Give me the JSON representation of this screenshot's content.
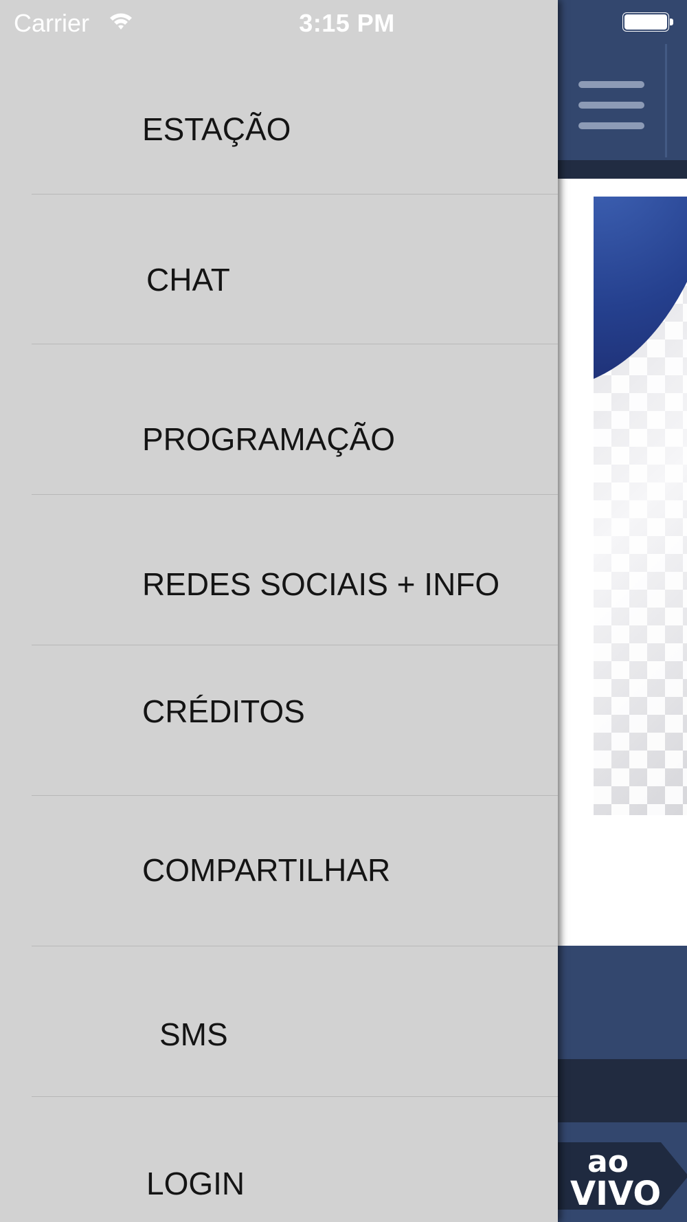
{
  "status_bar": {
    "carrier": "Carrier",
    "time": "3:15 PM",
    "wifi_icon": "wifi-icon",
    "battery_icon": "battery-full-icon",
    "battery_level": 1.0
  },
  "drawer": {
    "items": [
      {
        "label": "ESTAÇÃO"
      },
      {
        "label": "CHAT"
      },
      {
        "label": "PROGRAMAÇÃO"
      },
      {
        "label": "REDES SOCIAIS + INFO"
      },
      {
        "label": "CRÉDITOS"
      },
      {
        "label": "COMPARTILHAR"
      },
      {
        "label": "SMS"
      },
      {
        "label": "LOGIN"
      }
    ],
    "background_color": "#d2d2d2"
  },
  "app": {
    "menu_icon": "hamburger-menu-icon",
    "live_badge": {
      "line1": "ao",
      "line2": "VIVO"
    },
    "colors": {
      "primary": "#33476e",
      "dark": "#212b40"
    }
  }
}
